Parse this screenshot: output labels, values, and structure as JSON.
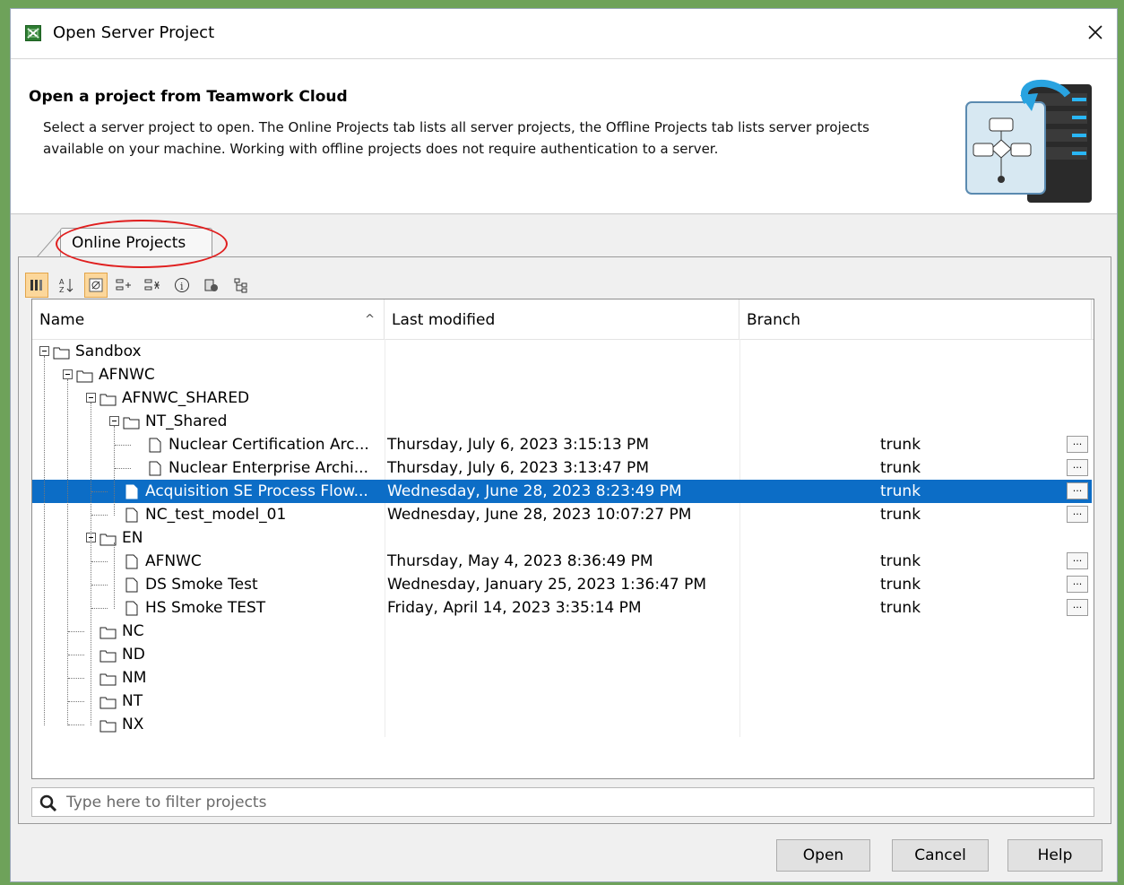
{
  "window": {
    "title": "Open Server Project",
    "close_label": "✕"
  },
  "header": {
    "title": "Open a project from Teamwork Cloud",
    "description": "Select a server project to open. The Online Projects tab lists all server projects, the Offline Projects tab lists server projects available on your machine. Working with offline projects does not require authentication to a server."
  },
  "tabs": [
    {
      "label": "Online Projects",
      "active": true
    }
  ],
  "toolbar": {
    "buttons": [
      {
        "icon": "columns-icon",
        "active": true
      },
      {
        "icon": "sort-az-icon",
        "active": false
      },
      {
        "icon": "filter-empty-icon",
        "active": true
      },
      {
        "icon": "expand-all-icon",
        "active": false
      },
      {
        "icon": "collapse-all-icon",
        "active": false
      },
      {
        "icon": "info-icon",
        "active": false
      },
      {
        "icon": "project-usages-icon",
        "active": false
      },
      {
        "icon": "hierarchy-icon",
        "active": false
      }
    ]
  },
  "table": {
    "columns": {
      "name": "Name",
      "last_modified": "Last modified",
      "branch": "Branch"
    },
    "sort_indicator": "^",
    "more_label": "...",
    "rows": [
      {
        "name": "Sandbox",
        "type": "folder",
        "expanded": true,
        "modified": "",
        "branch": ""
      },
      {
        "name": "AFNWC",
        "type": "folder",
        "expanded": true,
        "modified": "",
        "branch": ""
      },
      {
        "name": "AFNWC_SHARED",
        "type": "folder",
        "expanded": true,
        "modified": "",
        "branch": ""
      },
      {
        "name": "NT_Shared",
        "type": "folder",
        "expanded": true,
        "modified": "",
        "branch": ""
      },
      {
        "name": "Nuclear Certification Arc...",
        "type": "project",
        "modified": "Thursday, July 6, 2023 3:15:13 PM",
        "branch": "trunk"
      },
      {
        "name": "Nuclear Enterprise Archi...",
        "type": "project",
        "modified": "Thursday, July 6, 2023 3:13:47 PM",
        "branch": "trunk"
      },
      {
        "name": "Acquisition SE Process Flow...",
        "type": "project",
        "selected": true,
        "modified": "Wednesday, June 28, 2023 8:23:49 PM",
        "branch": "trunk"
      },
      {
        "name": "NC_test_model_01",
        "type": "project",
        "modified": "Wednesday, June 28, 2023 10:07:27 PM",
        "branch": "trunk"
      },
      {
        "name": "EN",
        "type": "folder",
        "expanded": true,
        "modified": "",
        "branch": ""
      },
      {
        "name": "AFNWC",
        "type": "project",
        "modified": "Thursday, May 4, 2023 8:36:49 PM",
        "branch": "trunk"
      },
      {
        "name": "DS Smoke Test",
        "type": "project",
        "modified": "Wednesday, January 25, 2023 1:36:47 PM",
        "branch": "trunk"
      },
      {
        "name": "HS Smoke TEST",
        "type": "project",
        "modified": "Friday, April 14, 2023 3:35:14 PM",
        "branch": "trunk"
      },
      {
        "name": "NC",
        "type": "folder",
        "modified": "",
        "branch": ""
      },
      {
        "name": "ND",
        "type": "folder",
        "modified": "",
        "branch": ""
      },
      {
        "name": "NM",
        "type": "folder",
        "modified": "",
        "branch": ""
      },
      {
        "name": "NT",
        "type": "folder",
        "modified": "",
        "branch": ""
      },
      {
        "name": "NX",
        "type": "folder",
        "modified": "",
        "branch": ""
      }
    ]
  },
  "filter": {
    "placeholder": "Type here to filter projects",
    "value": ""
  },
  "buttons": {
    "open": "Open",
    "cancel": "Cancel",
    "help": "Help"
  },
  "colors": {
    "selection": "#0c6dc6",
    "toolbar_active": "#fcd79b",
    "annotation_circle": "#e01e1e"
  }
}
